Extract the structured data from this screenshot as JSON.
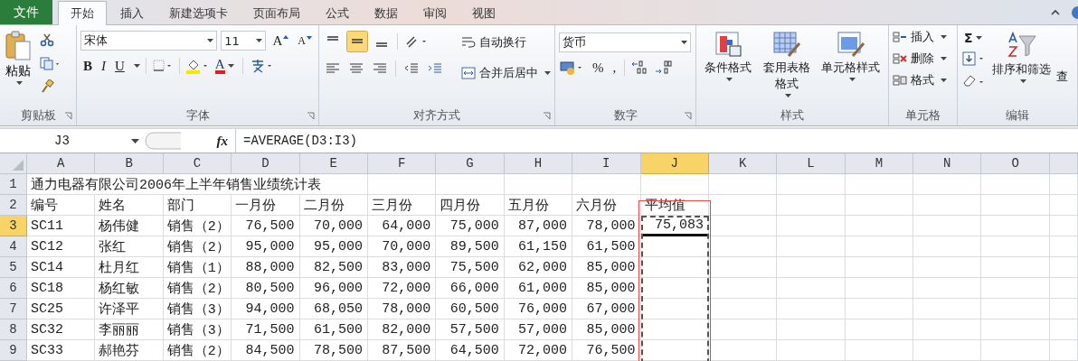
{
  "tabs": [
    {
      "label": "文件",
      "kind": "file",
      "selected": false
    },
    {
      "label": "开始",
      "kind": "tab",
      "selected": true
    },
    {
      "label": "插入",
      "kind": "tab",
      "selected": false
    },
    {
      "label": "新建选项卡",
      "kind": "tab",
      "selected": false
    },
    {
      "label": "页面布局",
      "kind": "tab",
      "selected": false
    },
    {
      "label": "公式",
      "kind": "tab",
      "selected": false
    },
    {
      "label": "数据",
      "kind": "tab",
      "selected": false
    },
    {
      "label": "审阅",
      "kind": "tab",
      "selected": false
    },
    {
      "label": "视图",
      "kind": "tab",
      "selected": false
    }
  ],
  "ribbon": {
    "clipboard": {
      "paste": "粘贴",
      "label": "剪贴板"
    },
    "font": {
      "name": "宋体",
      "size": "11",
      "grow": "A",
      "shrink": "A",
      "styles": [
        "B",
        "I",
        "U"
      ],
      "color_letter": "A",
      "label": "字体"
    },
    "alignment": {
      "wrap_text": "自动换行",
      "merge_center": "合并后居中",
      "label": "对齐方式"
    },
    "number": {
      "format": "货币",
      "percent": "%",
      "comma": ",",
      "label": "数字"
    },
    "styles": {
      "buttons": [
        "条件格式",
        "套用表格格式",
        "单元格样式"
      ],
      "label": "样式"
    },
    "cells": {
      "buttons": [
        "插入",
        "删除",
        "格式"
      ],
      "label": "单元格"
    },
    "editing": {
      "sum": "Σ",
      "sort_filter": "排序和筛选",
      "find": "查",
      "label": "编辑"
    }
  },
  "formula_bar": {
    "name_box": "J3",
    "fx": "fx",
    "formula": "=AVERAGE(D3:I3)"
  },
  "sheet": {
    "columns": [
      {
        "label": "A",
        "selected": false
      },
      {
        "label": "B",
        "selected": false
      },
      {
        "label": "C",
        "selected": false
      },
      {
        "label": "D",
        "selected": false
      },
      {
        "label": "E",
        "selected": false
      },
      {
        "label": "F",
        "selected": false
      },
      {
        "label": "G",
        "selected": false
      },
      {
        "label": "H",
        "selected": false
      },
      {
        "label": "I",
        "selected": false
      },
      {
        "label": "J",
        "selected": true
      },
      {
        "label": "K",
        "selected": false
      },
      {
        "label": "L",
        "selected": false
      },
      {
        "label": "M",
        "selected": false
      },
      {
        "label": "N",
        "selected": false
      },
      {
        "label": "O",
        "selected": false
      }
    ],
    "rows": [
      {
        "header": "1",
        "kind": "title",
        "selected": false,
        "cells": [
          "通力电器有限公司2006年上半年销售业绩统计表"
        ]
      },
      {
        "header": "2",
        "kind": "header",
        "selected": false,
        "cells": [
          "编号",
          "姓名",
          "部门",
          "一月份",
          "二月份",
          "三月份",
          "四月份",
          "五月份",
          "六月份",
          "平均值"
        ]
      },
      {
        "header": "3",
        "kind": "data",
        "selected": true,
        "cells": [
          "SC11",
          "杨伟健",
          "销售（2）",
          "76,500",
          "70,000",
          "64,000",
          "75,000",
          "87,000",
          "78,000",
          "75,083"
        ]
      },
      {
        "header": "4",
        "kind": "data",
        "selected": false,
        "cells": [
          "SC12",
          "张红",
          "销售（2）",
          "95,000",
          "95,000",
          "70,000",
          "89,500",
          "61,150",
          "61,500"
        ]
      },
      {
        "header": "5",
        "kind": "data",
        "selected": false,
        "cells": [
          "SC14",
          "杜月红",
          "销售（1）",
          "88,000",
          "82,500",
          "83,000",
          "75,500",
          "62,000",
          "85,000"
        ]
      },
      {
        "header": "6",
        "kind": "data",
        "selected": false,
        "cells": [
          "SC18",
          "杨红敏",
          "销售（2）",
          "80,500",
          "96,000",
          "72,000",
          "66,000",
          "61,000",
          "85,000"
        ]
      },
      {
        "header": "7",
        "kind": "data",
        "selected": false,
        "cells": [
          "SC25",
          "许泽平",
          "销售（3）",
          "94,000",
          "68,050",
          "78,000",
          "60,500",
          "76,000",
          "67,000"
        ]
      },
      {
        "header": "8",
        "kind": "data",
        "selected": false,
        "cells": [
          "SC32",
          "李丽丽",
          "销售（3）",
          "71,500",
          "61,500",
          "82,000",
          "57,500",
          "57,000",
          "85,000"
        ]
      },
      {
        "header": "9",
        "kind": "data",
        "selected": false,
        "cells": [
          "SC33",
          "郝艳芬",
          "销售（2）",
          "84,500",
          "78,500",
          "87,500",
          "64,500",
          "72,000",
          "76,500"
        ]
      }
    ]
  }
}
